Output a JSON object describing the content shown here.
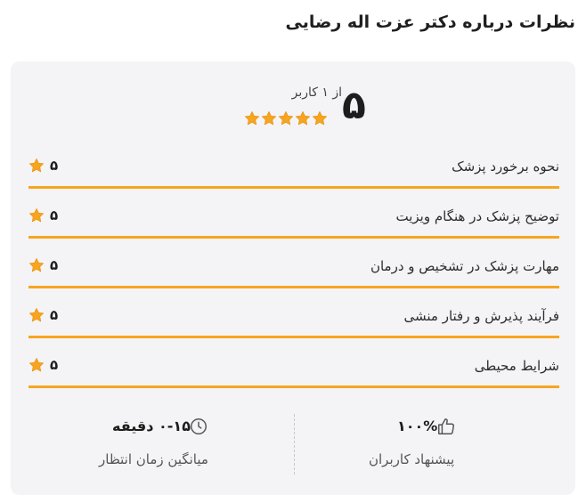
{
  "page_title": "نظرات درباره دکتر عزت اله رضایی",
  "summary": {
    "score": "۵",
    "out_of": "از ۱ کاربر",
    "stars": 5
  },
  "ratings": [
    {
      "label": "نحوه برخورد پزشک",
      "score": "۵"
    },
    {
      "label": "توضیح پزشک در هنگام ویزیت",
      "score": "۵"
    },
    {
      "label": "مهارت پزشک در تشخیص و درمان",
      "score": "۵"
    },
    {
      "label": "فرآیند پذیرش و رفتار منشی",
      "score": "۵"
    },
    {
      "label": "شرایط محیطی",
      "score": "۵"
    }
  ],
  "stats": {
    "recommend": {
      "value": "۱۰۰%",
      "label": "پیشنهاد کاربران",
      "icon": "thumbs-up-icon"
    },
    "wait_time": {
      "value": "۰-۱۵ دقیقه",
      "label": "میانگین زمان انتظار",
      "icon": "clock-icon"
    }
  },
  "colors": {
    "accent": "#f7a520",
    "card_bg": "#f4f4f6"
  }
}
